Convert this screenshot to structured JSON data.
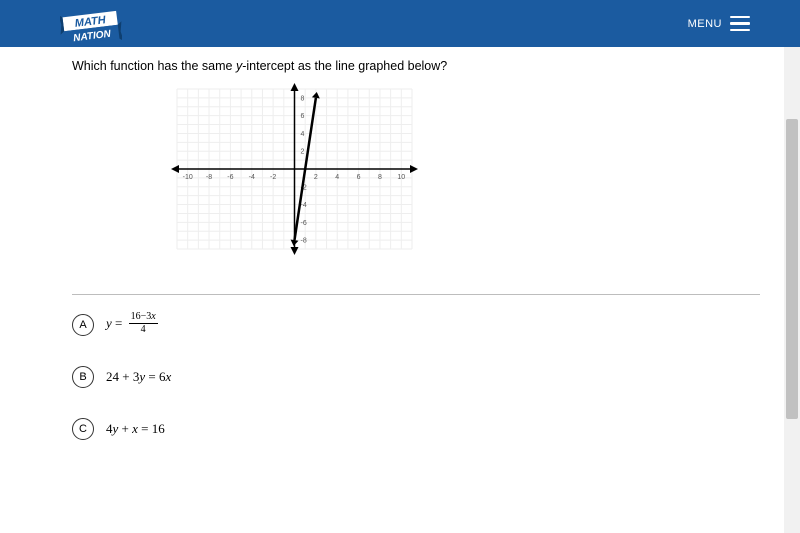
{
  "brand": {
    "logo_top": "MATH",
    "logo_bottom": "NATION"
  },
  "menu_label": "MENU",
  "question_pre": "Which function has the same ",
  "question_var": "y",
  "question_post": "-intercept as the line graphed below?",
  "chart_data": {
    "type": "line",
    "title": "",
    "xlabel": "",
    "ylabel": "",
    "xlim": [
      -11,
      11
    ],
    "ylim": [
      -9,
      9
    ],
    "xticks": [
      -10,
      -8,
      -6,
      -4,
      -2,
      0,
      2,
      4,
      6,
      8,
      10
    ],
    "yticks": [
      -8,
      -6,
      -4,
      -2,
      0,
      2,
      4,
      6,
      8
    ],
    "grid": true,
    "series": [
      {
        "name": "line",
        "x": [
          0,
          2
        ],
        "y": [
          -8,
          8
        ]
      }
    ],
    "y_intercept": -8
  },
  "choices": [
    {
      "letter": "A",
      "kind": "fraction",
      "lhs": "y",
      "eq": " = ",
      "num_a": "16",
      "num_op": "−",
      "num_b": "3",
      "num_var": "x",
      "den": "4"
    },
    {
      "letter": "B",
      "kind": "plain",
      "a": "24",
      "op1": " + ",
      "b": "3",
      "var1": "y",
      "eq": " = ",
      "c": "6",
      "var2": "x"
    },
    {
      "letter": "C",
      "kind": "plain",
      "a": "4",
      "var1": "y",
      "op1": " + ",
      "b": "",
      "var2_pre": "x",
      "eq": " = ",
      "c": "16"
    }
  ]
}
